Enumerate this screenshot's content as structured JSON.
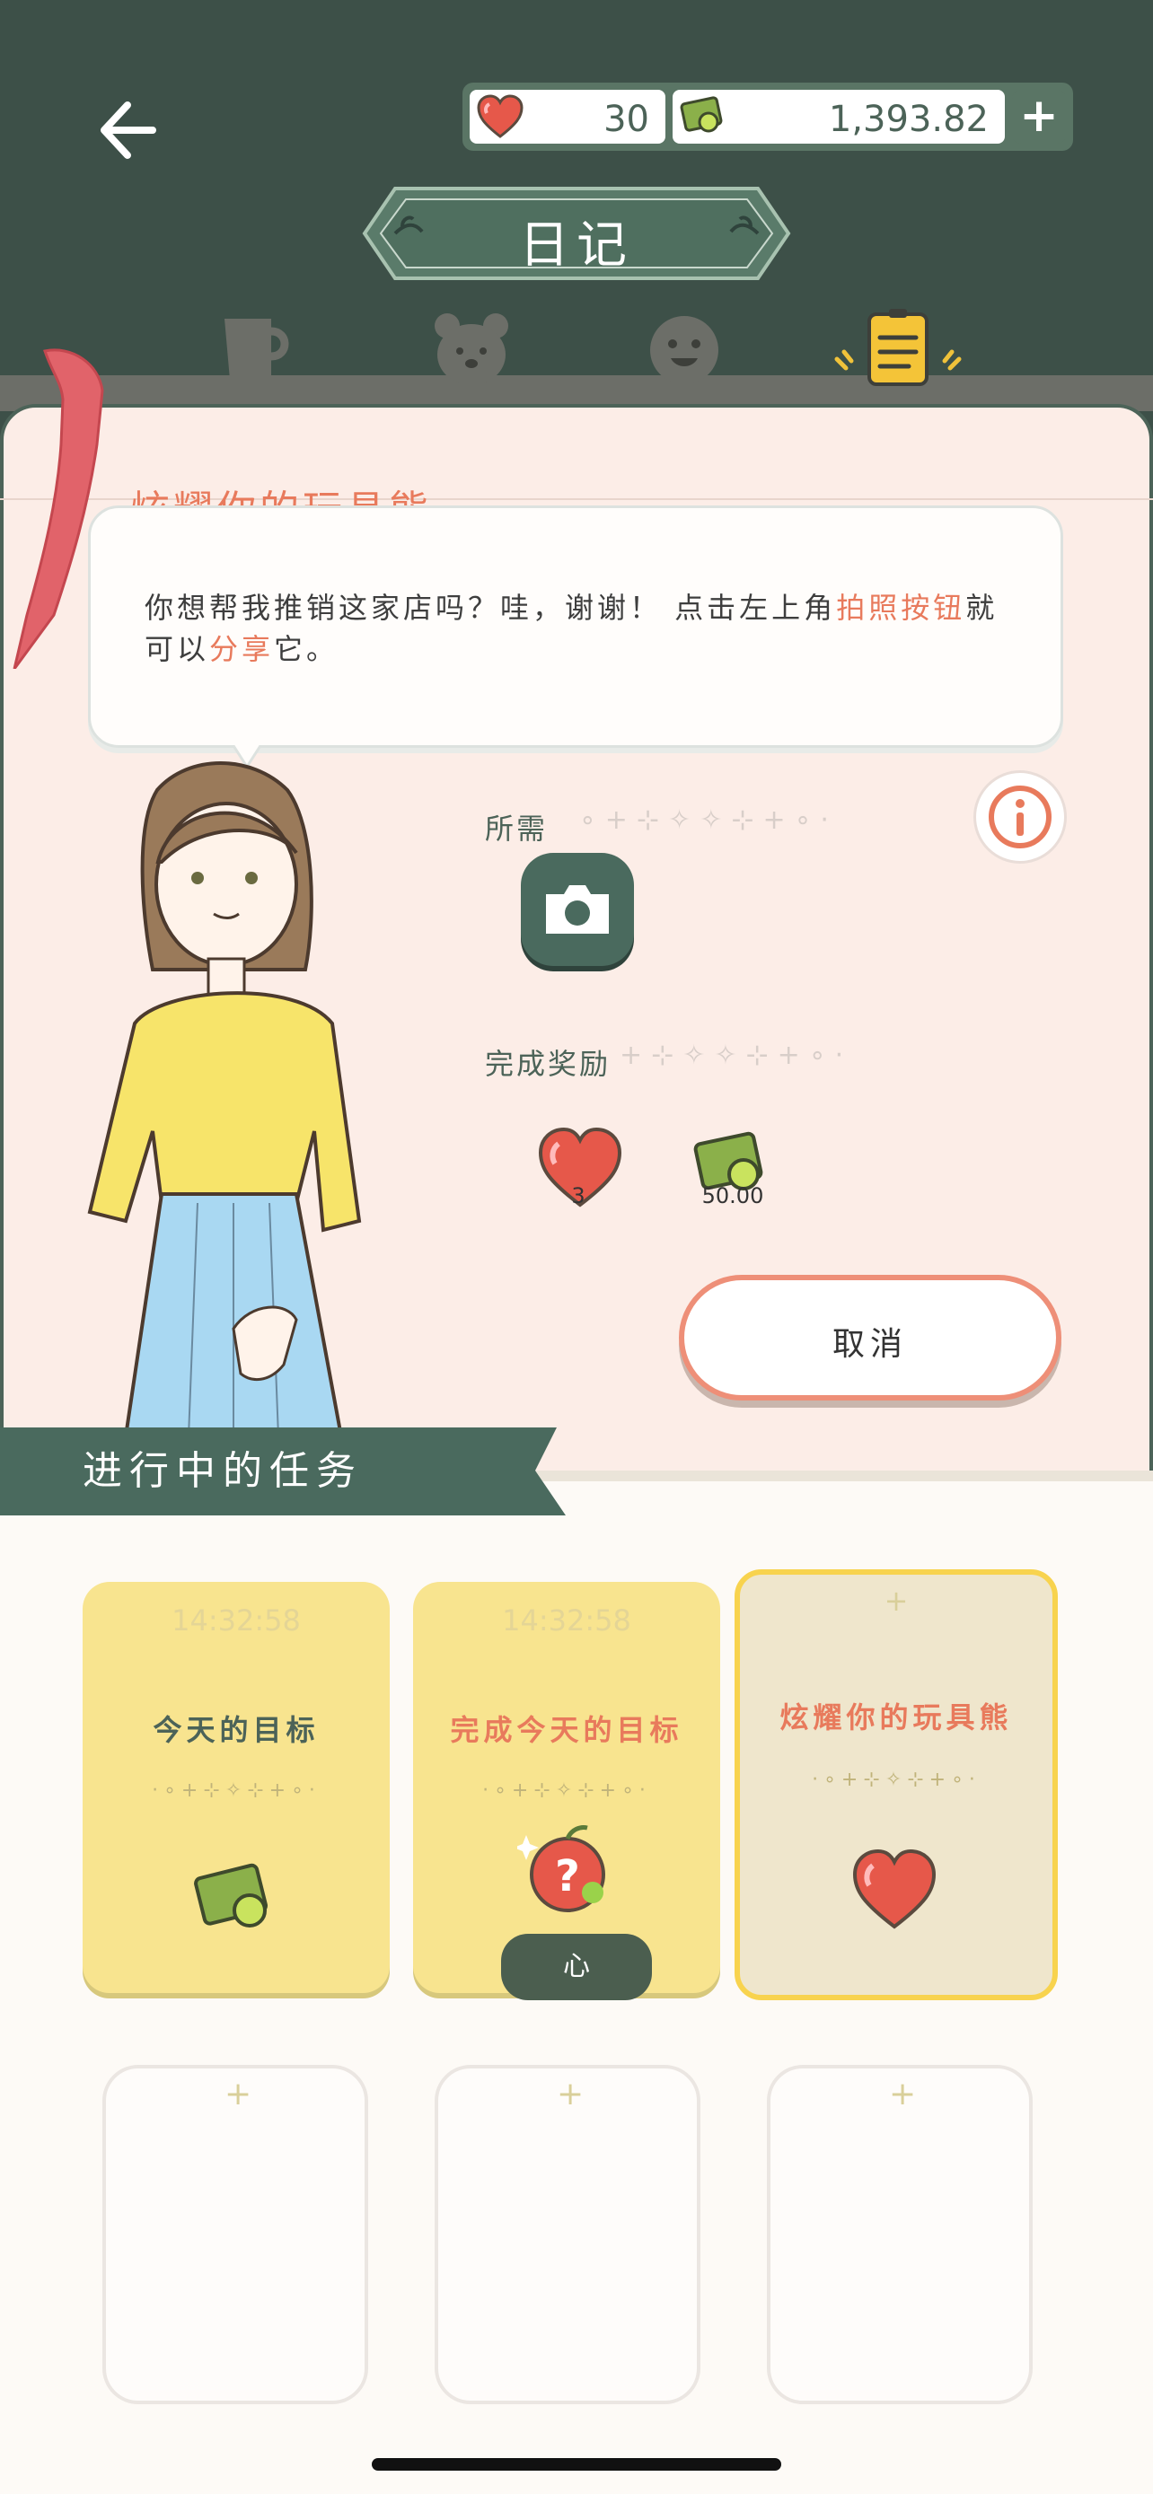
{
  "header": {
    "title": "日记",
    "hearts": "30",
    "money": "1,393.82",
    "plus_label": "+"
  },
  "tabs": [
    {
      "name": "cup-icon",
      "active": false
    },
    {
      "name": "bear-icon",
      "active": false
    },
    {
      "name": "smile-icon",
      "active": false
    },
    {
      "name": "diary-icon",
      "active": true
    }
  ],
  "quest": {
    "title": "炫耀你的玩具熊",
    "speech_part1": "你想帮我推销这家店吗？哇，谢谢！ 点击左上角",
    "speech_highlight1": "拍照按钮",
    "speech_part2": "就可以",
    "speech_highlight2": "分享",
    "speech_part3": "它。",
    "required_label": "所需",
    "reward_label": "完成奖励",
    "reward_heart": "3",
    "reward_money": "50.00",
    "cancel_label": "取消"
  },
  "ongoing": {
    "label": "进行中的任务",
    "cards": [
      {
        "time": "14:32:58",
        "name": "今天的目标",
        "name_color": "#4c6358",
        "icon": "money-icon"
      },
      {
        "time": "14:32:58",
        "name": "完成今天的目标",
        "name_color": "#e87a5c",
        "icon": "mystery-apple-icon",
        "tag": "心"
      },
      {
        "time": "",
        "name": "炫耀你的玩具熊",
        "name_color": "#e87a5c",
        "icon": "heart-icon"
      }
    ],
    "card_dots": "·∘+⊹✧⊹+∘·"
  },
  "colors": {
    "dark_green": "#3d5048",
    "accent_orange": "#e87a5c",
    "card_yellow": "#f8e48f",
    "panel_pink": "#fcede7"
  }
}
